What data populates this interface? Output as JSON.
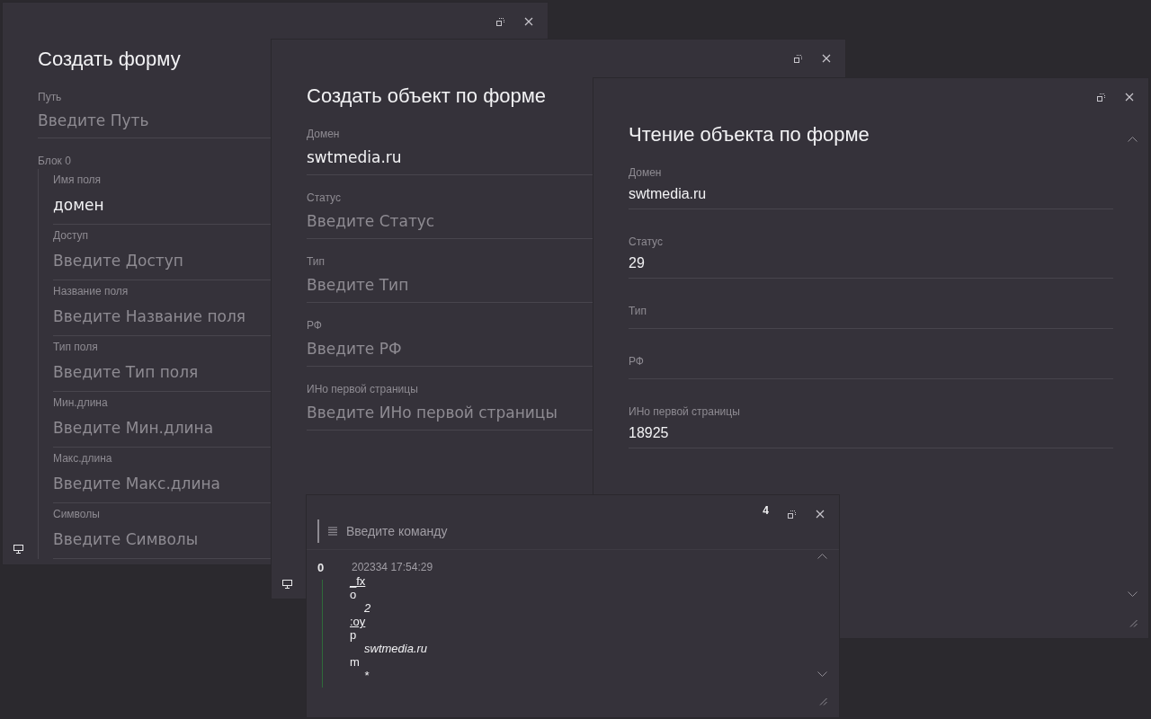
{
  "windows": [
    {
      "kind": "create_form",
      "title": "Создать форму",
      "fields": [
        {
          "label": "Путь",
          "placeholder": "Введите Путь"
        },
        {
          "kind": "group",
          "label": "Блок 0",
          "fields": [
            {
              "label": "Имя поля",
              "value": "домен"
            },
            {
              "label": "Доступ",
              "placeholder": "Введите Доступ"
            },
            {
              "label": "Название поля",
              "placeholder": "Введите Название поля"
            },
            {
              "label": "Тип поля",
              "placeholder": "Введите Тип поля"
            },
            {
              "label": "Мин.длина",
              "placeholder": "Введите Мин.длина"
            },
            {
              "label": "Макс.длина",
              "placeholder": "Введите Макс.длина"
            },
            {
              "label": "Символы",
              "placeholder": "Введите Символы"
            }
          ]
        }
      ]
    },
    {
      "kind": "create_object",
      "title": "Создать объект по форме",
      "fields": [
        {
          "label": "Домен",
          "value": "swtmedia.ru"
        },
        {
          "label": "Статус",
          "placeholder": "Введите Статус"
        },
        {
          "label": "Тип",
          "placeholder": "Введите Тип"
        },
        {
          "label": "РФ",
          "placeholder": "Введите РФ"
        },
        {
          "label": "ИНо первой страницы",
          "placeholder": "Введите ИНо первой страницы"
        }
      ]
    },
    {
      "kind": "read_object",
      "title": "Чтение объекта по форме",
      "fields": [
        {
          "label": "Домен",
          "value": "swtmedia.ru"
        },
        {
          "label": "Статус",
          "value": "29"
        },
        {
          "label": "Тип"
        },
        {
          "label": "РФ"
        },
        {
          "label": "ИНо первой страницы",
          "value": "18925"
        }
      ]
    },
    {
      "kind": "console",
      "count": "4",
      "command": {
        "placeholder": "Введите команду"
      },
      "log": [
        {
          "index": "0",
          "time": "202334 17:54:29",
          "lines": [
            {
              "kind": "link",
              "text": "_fx"
            },
            {
              "kind": "plain",
              "text": "o"
            },
            {
              "kind": "italic",
              "text": "2"
            },
            {
              "kind": "link",
              "text": ":oy"
            },
            {
              "kind": "plain",
              "text": "p"
            },
            {
              "kind": "italic",
              "text": "swtmedia.ru"
            },
            {
              "kind": "plain",
              "text": "m"
            },
            {
              "kind": "italic",
              "text": "*"
            }
          ]
        }
      ]
    }
  ]
}
